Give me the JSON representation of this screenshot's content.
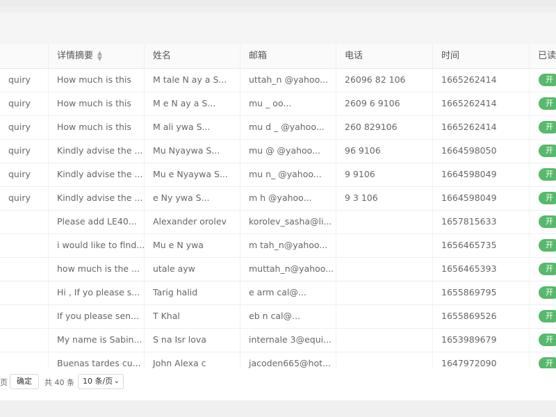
{
  "table": {
    "headers": [
      "",
      "详情摘要",
      "姓名",
      "邮箱",
      "电话",
      "时间",
      "已读"
    ],
    "rows": [
      {
        "type": "quiry",
        "summary": "How much is this",
        "name": "M  tale N  ay  a S...",
        "email": "  uttah_n  @yahoo...",
        "phone": "26096  82  106",
        "time": "1665262414",
        "status": "开"
      },
      {
        "type": "quiry",
        "summary": "How much is this",
        "name": "M   e N  ay  a S...",
        "email": "mu    _         oo...",
        "phone": "2609  6   9106",
        "time": "1665262414",
        "status": "开"
      },
      {
        "type": "quiry",
        "summary": "How much is this",
        "name": "M  ali   ywa S...",
        "email": "mu   d  _   @yahoo...",
        "phone": "260   829106",
        "time": "1665262414",
        "status": "开"
      },
      {
        "type": "quiry",
        "summary": "Kindly advise the ...",
        "name": "Mu    Nyaywa S...",
        "email": "mu    @  @yahoo...",
        "phone": "96   9106",
        "time": "1664598050",
        "status": "开"
      },
      {
        "type": "quiry",
        "summary": "Kindly advise the ...",
        "name": "Mu   e Nyaywa S...",
        "email": "mu   n_  @yahoo...",
        "phone": "9   9106",
        "time": "1664598049",
        "status": "开"
      },
      {
        "type": "quiry",
        "summary": "Kindly advise the ...",
        "name": "   e Ny  ywa S...",
        "email": "m   h   @yahoo...",
        "phone": "9   3  106",
        "time": "1664598049",
        "status": "开"
      },
      {
        "type": "",
        "summary": "Please add LE40...",
        "name": "Alexander  orolev",
        "email": "korolev_sasha@li...",
        "phone": "",
        "time": "1657815633",
        "status": "开"
      },
      {
        "type": "",
        "summary": "i would like to find...",
        "name": "Mu   e N  ywa",
        "email": "m   tah_n@yahoo...",
        "phone": "",
        "time": "1656465735",
        "status": "开"
      },
      {
        "type": "",
        "summary": "how much is the ...",
        "name": "  utale   ayw  ",
        "email": "muttah_n@yahoo...",
        "phone": "",
        "time": "1656465393",
        "status": "开"
      },
      {
        "type": "",
        "summary": "Hi , If yo please s...",
        "name": "Tarig   halid",
        "email": "e    arm   cal@...",
        "phone": "",
        "time": "1655869795",
        "status": "开"
      },
      {
        "type": "",
        "summary": "If you please sen...",
        "name": "T   Khal  ",
        "email": "eb    n    cal@...",
        "phone": "",
        "time": "1655869526",
        "status": "开"
      },
      {
        "type": "",
        "summary": "My name is Sabin...",
        "name": "S  na Isr  lova",
        "email": "internale  3@equi...",
        "phone": "",
        "time": "1653989679",
        "status": "开"
      },
      {
        "type": "",
        "summary": "Buenas tardes cu...",
        "name": "John Alexa   c",
        "email": "jacoden665@hot...",
        "phone": "",
        "time": "1647972090",
        "status": "开"
      }
    ]
  },
  "pager": {
    "page_suffix": "页",
    "confirm_label": "确定",
    "total": "共 40 条",
    "size_option": "10 条/页"
  },
  "icons": {
    "sort": "sort-icon",
    "chevron": "chevron-down-icon"
  },
  "colors": {
    "status": "#57b96b"
  }
}
